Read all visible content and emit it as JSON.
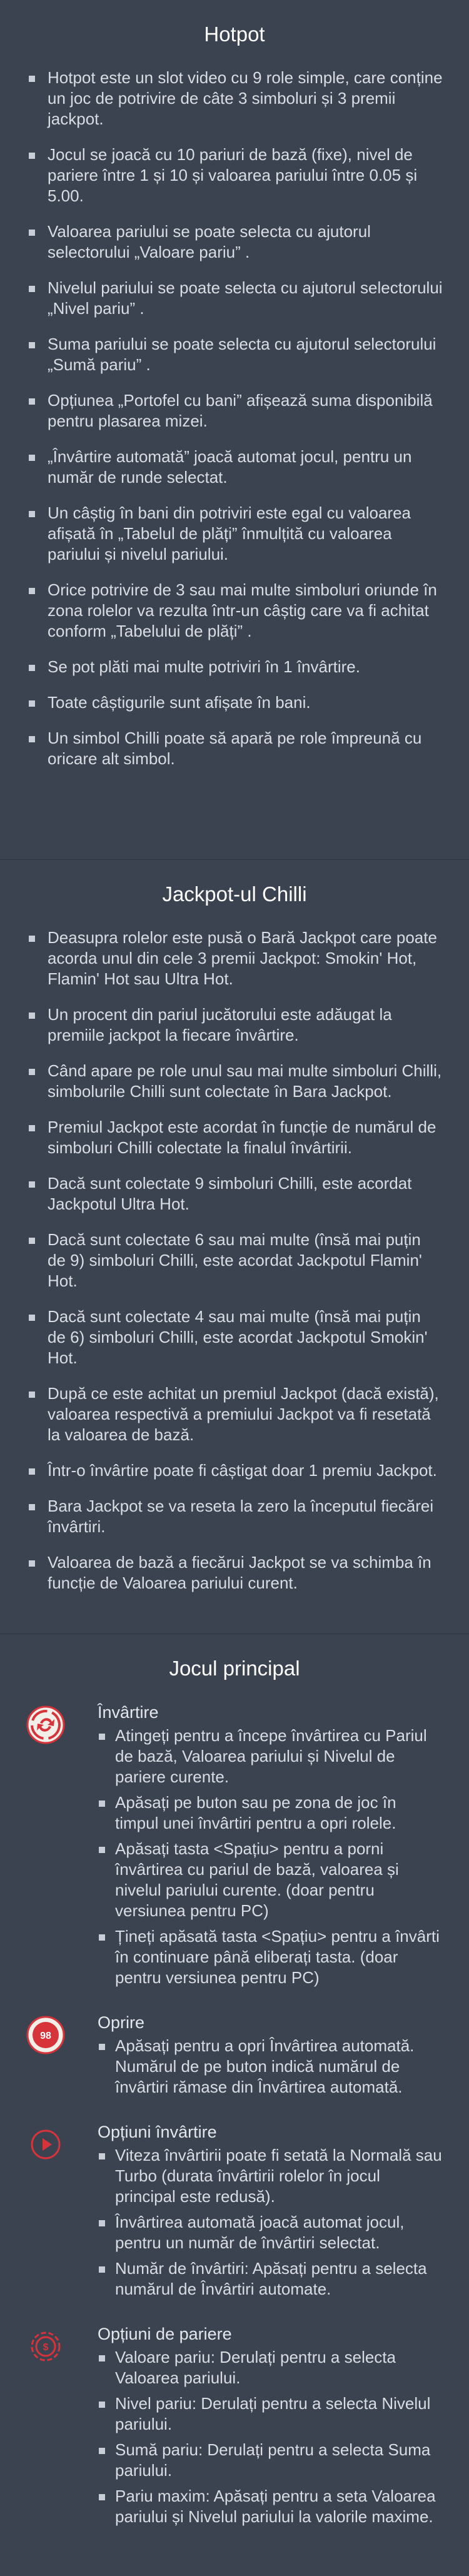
{
  "hotpot": {
    "title": "Hotpot",
    "items": [
      "Hotpot este un slot video cu 9 role simple, care conține un joc de potrivire de câte 3 simboluri și 3 premii jackpot.",
      "Jocul se joacă cu 10 pariuri de bază (fixe), nivel de pariere între 1 și 10 și valoarea pariului între 0.05 și 5.00.",
      "Valoarea pariului se poate selecta cu ajutorul selectorului „Valoare pariu” .",
      "Nivelul pariului se poate selecta cu ajutorul selectorului „Nivel pariu” .",
      "Suma pariului se poate selecta cu ajutorul selectorului „Sumă pariu” .",
      "Opțiunea „Portofel cu bani”  afișează suma disponibilă pentru plasarea mizei.",
      "„Învârtire automată”  joacă automat jocul, pentru un număr de runde selectat.",
      "Un câștig în bani din potriviri este egal cu valoarea afișată în „Tabelul de plăți”  înmulțită cu valoarea pariului și nivelul pariului.",
      "Orice potrivire de 3 sau mai multe simboluri oriunde în zona rolelor va rezulta într-un câștig care va fi achitat conform „Tabelului de plăți” .",
      "Se pot plăti mai multe potriviri în 1 învârtire.",
      "Toate câștigurile sunt afișate în bani.",
      "Un simbol Chilli poate să apară pe role împreună cu oricare alt simbol."
    ]
  },
  "jackpot": {
    "title": "Jackpot-ul Chilli",
    "items": [
      "Deasupra rolelor este pusă o Bară Jackpot care poate acorda unul din cele 3 premii Jackpot: Smokin' Hot, Flamin' Hot sau Ultra Hot.",
      "Un procent din pariul jucătorului este adăugat la premiile jackpot la fiecare învârtire.",
      "Când apare pe role unul sau mai multe simboluri Chilli, simbolurile Chilli sunt colectate în Bara Jackpot.",
      "Premiul Jackpot este acordat în funcție de numărul de simboluri Chilli colectate la finalul învârtirii.",
      "Dacă sunt colectate 9 simboluri Chilli, este acordat Jackpotul Ultra Hot.",
      "Dacă sunt colectate 6 sau mai multe (însă mai puțin de 9) simboluri Chilli, este acordat Jackpotul Flamin' Hot.",
      "Dacă sunt colectate 4 sau mai multe (însă mai puțin de 6) simboluri Chilli, este acordat Jackpotul Smokin' Hot.",
      "După ce este achitat un premiul Jackpot (dacă există), valoarea respectivă a premiului Jackpot va fi resetată la valoarea de bază.",
      "Într-o învârtire poate fi câștigat doar 1 premiu Jackpot.",
      "Bara Jackpot se va reseta la zero la începutul fiecărei învârtiri.",
      "Valoarea de bază a fiecărui Jackpot se va schimba în funcție de Valoarea pariului curent."
    ]
  },
  "main_game": {
    "title": "Jocul principal",
    "features": [
      {
        "icon": "spin-icon",
        "title": "Învârtire",
        "items": [
          "Atingeți pentru a începe învârtirea cu Pariul de bază, Valoarea pariului și Nivelul de pariere curente.",
          "Apăsați pe buton sau pe zona de joc în timpul unei învârtiri pentru a opri rolele.",
          "Apăsați tasta <Spațiu> pentru a porni învârtirea cu pariul de bază, valoarea și nivelul pariului curente. (doar pentru versiunea pentru PC)",
          "Țineți apăsată tasta <Spațiu> pentru a învârti în continuare până eliberați tasta. (doar pentru versiunea pentru PC)"
        ]
      },
      {
        "icon": "stop-icon",
        "icon_label": "98",
        "title": "Oprire",
        "items": [
          "Apăsați pentru a opri Învârtirea automată. Numărul de pe buton indică numărul de învârtiri rămase din Învârtirea automată."
        ]
      },
      {
        "icon": "play-icon",
        "title": "Opțiuni învârtire",
        "items": [
          "Viteza învârtirii poate fi setată la Normală sau Turbo (durata învârtirii rolelor în jocul principal este redusă).",
          "Învârtirea automată joacă automat jocul, pentru un număr de învârtiri selectat.",
          "Număr de învârtiri: Apăsați pentru a selecta numărul de Învârtiri automate."
        ]
      },
      {
        "icon": "coin-icon",
        "title": "Opțiuni de pariere",
        "items": [
          "Valoare pariu: Derulați pentru a selecta Valoarea pariului.",
          "Nivel pariu: Derulați pentru a selecta Nivelul pariului.",
          "Sumă pariu: Derulați pentru a selecta Suma pariului.",
          "Pariu maxim: Apăsați pentru a seta Valoarea pariului și Nivelul pariului la valorile maxime."
        ]
      }
    ]
  },
  "colors": {
    "background": "#3c4350",
    "text": "#d9dde3",
    "title": "#ffffff",
    "accent": "#d6333a"
  }
}
